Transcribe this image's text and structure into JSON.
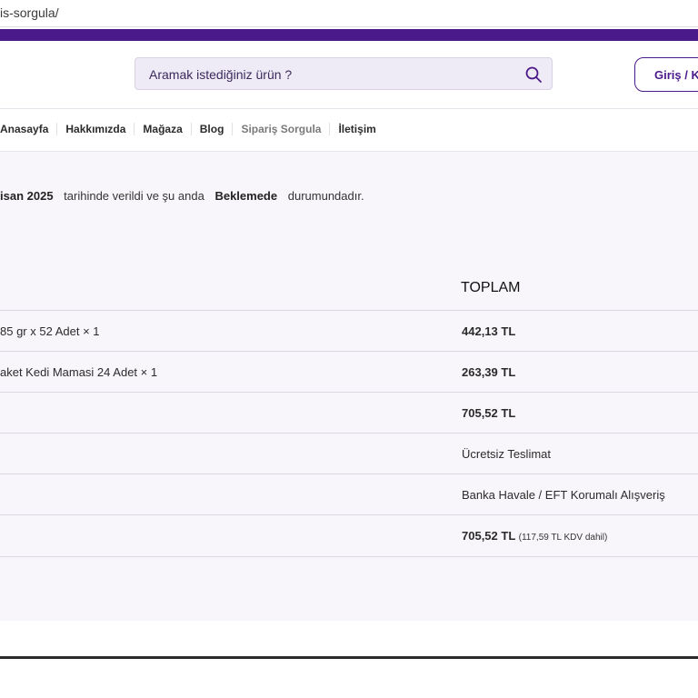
{
  "browser": {
    "url_fragment": "is-sorgula/"
  },
  "header": {
    "search_placeholder": "Aramak istediğiniz ürün ?",
    "login_label": "Giriş / Ka"
  },
  "nav": {
    "items": [
      "Anasayfa",
      "Hakkımızda",
      "Mağaza",
      "Blog",
      "Sipariş Sorgula",
      "İletişim"
    ]
  },
  "order": {
    "date_fragment": "isan 2025",
    "text_before_status": "tarihinde verildi ve şu anda",
    "status": "Beklemede",
    "text_after_status": "durumundadır.",
    "total_header": "TOPLAM",
    "rows": [
      {
        "label": "85 gr x 52 Adet × 1",
        "value": "442,13 TL"
      },
      {
        "label": "aket Kedi Mamasi 24 Adet × 1",
        "value": "263,39 TL"
      },
      {
        "label": "",
        "value": "705,52 TL"
      },
      {
        "label": "",
        "value": "Ücretsiz Teslimat"
      },
      {
        "label": "",
        "value": "Banka Havale / EFT Korumalı Alışveriş"
      },
      {
        "label": "",
        "value": "705,52 TL",
        "note": "(117,59 TL KDV dahil)"
      }
    ]
  },
  "colors": {
    "brand": "#4b1a8a",
    "content_bg": "#f8f6fa",
    "search_bg": "#efebf6"
  }
}
